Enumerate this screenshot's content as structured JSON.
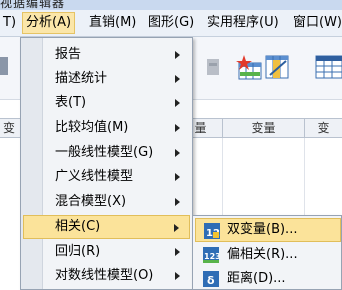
{
  "window": {
    "title": "视据编辑器"
  },
  "menubar": {
    "items": [
      {
        "label": "T)"
      },
      {
        "label": "分析(A)"
      },
      {
        "label": "直销(M)"
      },
      {
        "label": "图形(G)"
      },
      {
        "label": "实用程序(U)"
      },
      {
        "label": "窗口(W)"
      }
    ]
  },
  "grid": {
    "columns": [
      {
        "label": "变"
      },
      {
        "label": "量"
      },
      {
        "label": "变量"
      },
      {
        "label": "变"
      }
    ]
  },
  "analyze_menu": {
    "items": [
      {
        "label": "报告"
      },
      {
        "label": "描述统计"
      },
      {
        "label": "表(T)"
      },
      {
        "label": "比较均值(M)"
      },
      {
        "label": "一般线性模型(G)"
      },
      {
        "label": "广义线性模型"
      },
      {
        "label": "混合模型(X)"
      },
      {
        "label": "相关(C)"
      },
      {
        "label": "回归(R)"
      },
      {
        "label": "对数线性模型(O)"
      }
    ]
  },
  "correlate_submenu": {
    "items": [
      {
        "label": "双变量(B)...",
        "icon": "bivariate-icon"
      },
      {
        "label": "偏相关(R)...",
        "icon": "partial-correlation-icon"
      },
      {
        "label": "距离(D)...",
        "icon": "distances-icon"
      }
    ]
  },
  "colors": {
    "highlight": "#fbe39a",
    "highlight_border": "#e1be5a",
    "menu_bg": "#f2f4f7",
    "menubar_bg": "#ecf1f8"
  }
}
